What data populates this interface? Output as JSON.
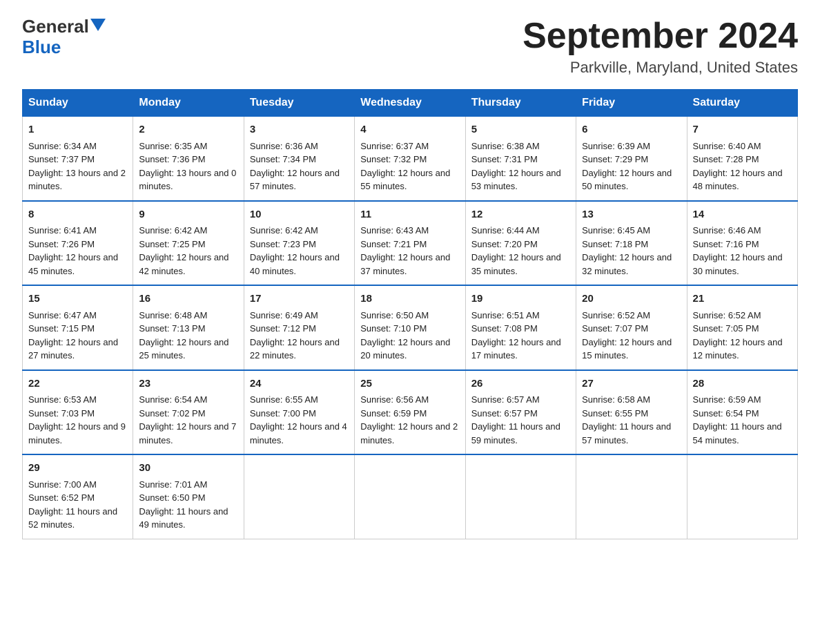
{
  "logo": {
    "general": "General",
    "blue": "Blue"
  },
  "title": "September 2024",
  "location": "Parkville, Maryland, United States",
  "days_of_week": [
    "Sunday",
    "Monday",
    "Tuesday",
    "Wednesday",
    "Thursday",
    "Friday",
    "Saturday"
  ],
  "weeks": [
    [
      {
        "day": "1",
        "sunrise": "6:34 AM",
        "sunset": "7:37 PM",
        "daylight": "13 hours and 2 minutes."
      },
      {
        "day": "2",
        "sunrise": "6:35 AM",
        "sunset": "7:36 PM",
        "daylight": "13 hours and 0 minutes."
      },
      {
        "day": "3",
        "sunrise": "6:36 AM",
        "sunset": "7:34 PM",
        "daylight": "12 hours and 57 minutes."
      },
      {
        "day": "4",
        "sunrise": "6:37 AM",
        "sunset": "7:32 PM",
        "daylight": "12 hours and 55 minutes."
      },
      {
        "day": "5",
        "sunrise": "6:38 AM",
        "sunset": "7:31 PM",
        "daylight": "12 hours and 53 minutes."
      },
      {
        "day": "6",
        "sunrise": "6:39 AM",
        "sunset": "7:29 PM",
        "daylight": "12 hours and 50 minutes."
      },
      {
        "day": "7",
        "sunrise": "6:40 AM",
        "sunset": "7:28 PM",
        "daylight": "12 hours and 48 minutes."
      }
    ],
    [
      {
        "day": "8",
        "sunrise": "6:41 AM",
        "sunset": "7:26 PM",
        "daylight": "12 hours and 45 minutes."
      },
      {
        "day": "9",
        "sunrise": "6:42 AM",
        "sunset": "7:25 PM",
        "daylight": "12 hours and 42 minutes."
      },
      {
        "day": "10",
        "sunrise": "6:42 AM",
        "sunset": "7:23 PM",
        "daylight": "12 hours and 40 minutes."
      },
      {
        "day": "11",
        "sunrise": "6:43 AM",
        "sunset": "7:21 PM",
        "daylight": "12 hours and 37 minutes."
      },
      {
        "day": "12",
        "sunrise": "6:44 AM",
        "sunset": "7:20 PM",
        "daylight": "12 hours and 35 minutes."
      },
      {
        "day": "13",
        "sunrise": "6:45 AM",
        "sunset": "7:18 PM",
        "daylight": "12 hours and 32 minutes."
      },
      {
        "day": "14",
        "sunrise": "6:46 AM",
        "sunset": "7:16 PM",
        "daylight": "12 hours and 30 minutes."
      }
    ],
    [
      {
        "day": "15",
        "sunrise": "6:47 AM",
        "sunset": "7:15 PM",
        "daylight": "12 hours and 27 minutes."
      },
      {
        "day": "16",
        "sunrise": "6:48 AM",
        "sunset": "7:13 PM",
        "daylight": "12 hours and 25 minutes."
      },
      {
        "day": "17",
        "sunrise": "6:49 AM",
        "sunset": "7:12 PM",
        "daylight": "12 hours and 22 minutes."
      },
      {
        "day": "18",
        "sunrise": "6:50 AM",
        "sunset": "7:10 PM",
        "daylight": "12 hours and 20 minutes."
      },
      {
        "day": "19",
        "sunrise": "6:51 AM",
        "sunset": "7:08 PM",
        "daylight": "12 hours and 17 minutes."
      },
      {
        "day": "20",
        "sunrise": "6:52 AM",
        "sunset": "7:07 PM",
        "daylight": "12 hours and 15 minutes."
      },
      {
        "day": "21",
        "sunrise": "6:52 AM",
        "sunset": "7:05 PM",
        "daylight": "12 hours and 12 minutes."
      }
    ],
    [
      {
        "day": "22",
        "sunrise": "6:53 AM",
        "sunset": "7:03 PM",
        "daylight": "12 hours and 9 minutes."
      },
      {
        "day": "23",
        "sunrise": "6:54 AM",
        "sunset": "7:02 PM",
        "daylight": "12 hours and 7 minutes."
      },
      {
        "day": "24",
        "sunrise": "6:55 AM",
        "sunset": "7:00 PM",
        "daylight": "12 hours and 4 minutes."
      },
      {
        "day": "25",
        "sunrise": "6:56 AM",
        "sunset": "6:59 PM",
        "daylight": "12 hours and 2 minutes."
      },
      {
        "day": "26",
        "sunrise": "6:57 AM",
        "sunset": "6:57 PM",
        "daylight": "11 hours and 59 minutes."
      },
      {
        "day": "27",
        "sunrise": "6:58 AM",
        "sunset": "6:55 PM",
        "daylight": "11 hours and 57 minutes."
      },
      {
        "day": "28",
        "sunrise": "6:59 AM",
        "sunset": "6:54 PM",
        "daylight": "11 hours and 54 minutes."
      }
    ],
    [
      {
        "day": "29",
        "sunrise": "7:00 AM",
        "sunset": "6:52 PM",
        "daylight": "11 hours and 52 minutes."
      },
      {
        "day": "30",
        "sunrise": "7:01 AM",
        "sunset": "6:50 PM",
        "daylight": "11 hours and 49 minutes."
      },
      null,
      null,
      null,
      null,
      null
    ]
  ]
}
